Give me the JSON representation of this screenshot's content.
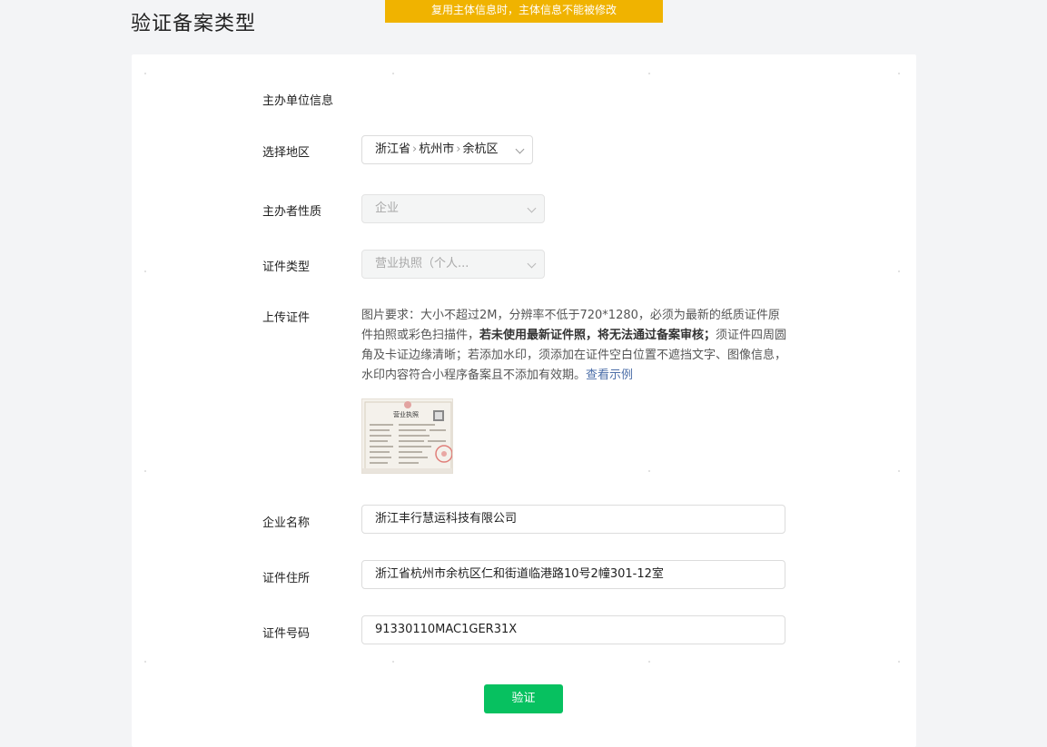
{
  "page_title": "验证备案类型",
  "warning_banner": "复用主体信息时，主体信息不能被修改",
  "section_title": "主办单位信息",
  "region": {
    "label": "选择地区",
    "province": "浙江省",
    "city": "杭州市",
    "district": "余杭区"
  },
  "nature": {
    "label": "主办者性质",
    "value": "企业"
  },
  "cert_type": {
    "label": "证件类型",
    "value": "营业执照（个人..."
  },
  "upload": {
    "label": "上传证件",
    "desc_part1": "图片要求：大小不超过2M，分辨率不低于720*1280，必须为最新的纸质证件原件拍照或彩色扫描件，",
    "desc_bold": "若未使用最新证件照，将无法通过备案审核；",
    "desc_part2": "须证件四周圆角及卡证边缘清晰；若添加水印，须添加在证件空白位置不遮挡文字、图像信息，水印内容符合小程序备案且不添加有效期。",
    "example_link": "查看示例",
    "license_title": "营业执照"
  },
  "company_name": {
    "label": "企业名称",
    "value": "浙江丰行慧运科技有限公司"
  },
  "address": {
    "label": "证件住所",
    "value": "浙江省杭州市余杭区仁和街道临港路10号2幢301-12室"
  },
  "cert_number": {
    "label": "证件号码",
    "value": "91330110MAC1GER31X"
  },
  "verify_button": "验证",
  "colors": {
    "accent_green": "#07c160",
    "banner_yellow": "#f0b300",
    "link_blue": "#4b6ea8"
  }
}
